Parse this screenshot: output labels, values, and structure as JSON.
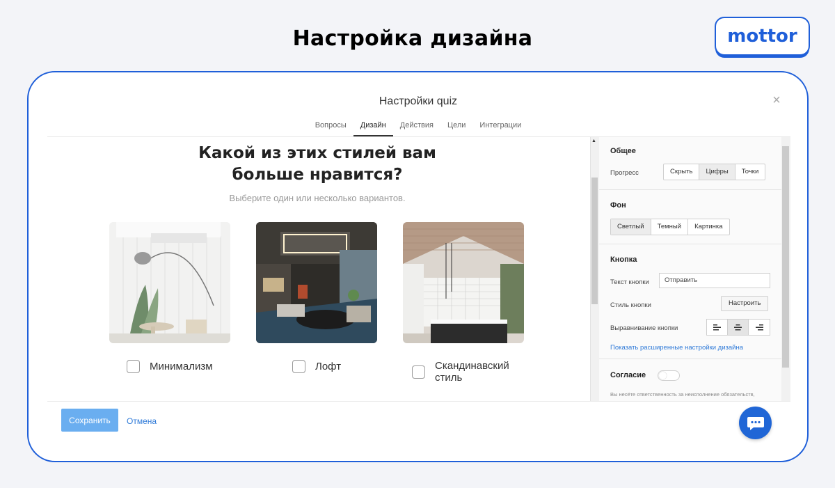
{
  "page": {
    "heading": "Настройка дизайна"
  },
  "brand": {
    "logo_text": "mottor"
  },
  "modal": {
    "title": "Настройки quiz",
    "tabs": [
      {
        "label": "Вопросы"
      },
      {
        "label": "Дизайн",
        "active": true
      },
      {
        "label": "Действия"
      },
      {
        "label": "Цели"
      },
      {
        "label": "Интеграции"
      }
    ],
    "close_icon": "close-icon"
  },
  "preview": {
    "question_title_line1": "Какой из этих стилей вам",
    "question_title_line2": "больше нравится?",
    "subtitle": "Выберите один или несколько вариантов.",
    "options": [
      {
        "label": "Минимализм",
        "checked": false
      },
      {
        "label": "Лофт",
        "checked": false
      },
      {
        "label": "Скандинавский стиль",
        "checked": false
      }
    ]
  },
  "settings": {
    "general": {
      "title": "Общее",
      "progress_label": "Прогресс",
      "progress_options": [
        "Скрыть",
        "Цифры",
        "Точки"
      ],
      "progress_selected": "Цифры"
    },
    "background": {
      "title": "Фон",
      "options": [
        "Светлый",
        "Темный",
        "Картинка"
      ],
      "selected": "Светлый"
    },
    "button": {
      "title": "Кнопка",
      "text_label": "Текст кнопки",
      "text_value": "Отправить",
      "style_label": "Стиль кнопки",
      "style_action": "Настроить",
      "align_label": "Выравнивание кнопки",
      "align_selected": "center",
      "advanced_link": "Показать расширенные настройки дизайна"
    },
    "consent": {
      "title": "Согласие",
      "enabled": false,
      "note": "Вы несёте ответственность за неисполнение обязательств, связанных с Федеральным законом о"
    }
  },
  "footer": {
    "save_label": "Сохранить",
    "cancel_label": "Отмена"
  },
  "colors": {
    "brand_blue": "#1f5fd9",
    "save_button": "#6aaef0",
    "link": "#2f7ad8",
    "chat_button": "#2066d6"
  },
  "chat": {
    "icon": "chat-bubble-icon"
  }
}
